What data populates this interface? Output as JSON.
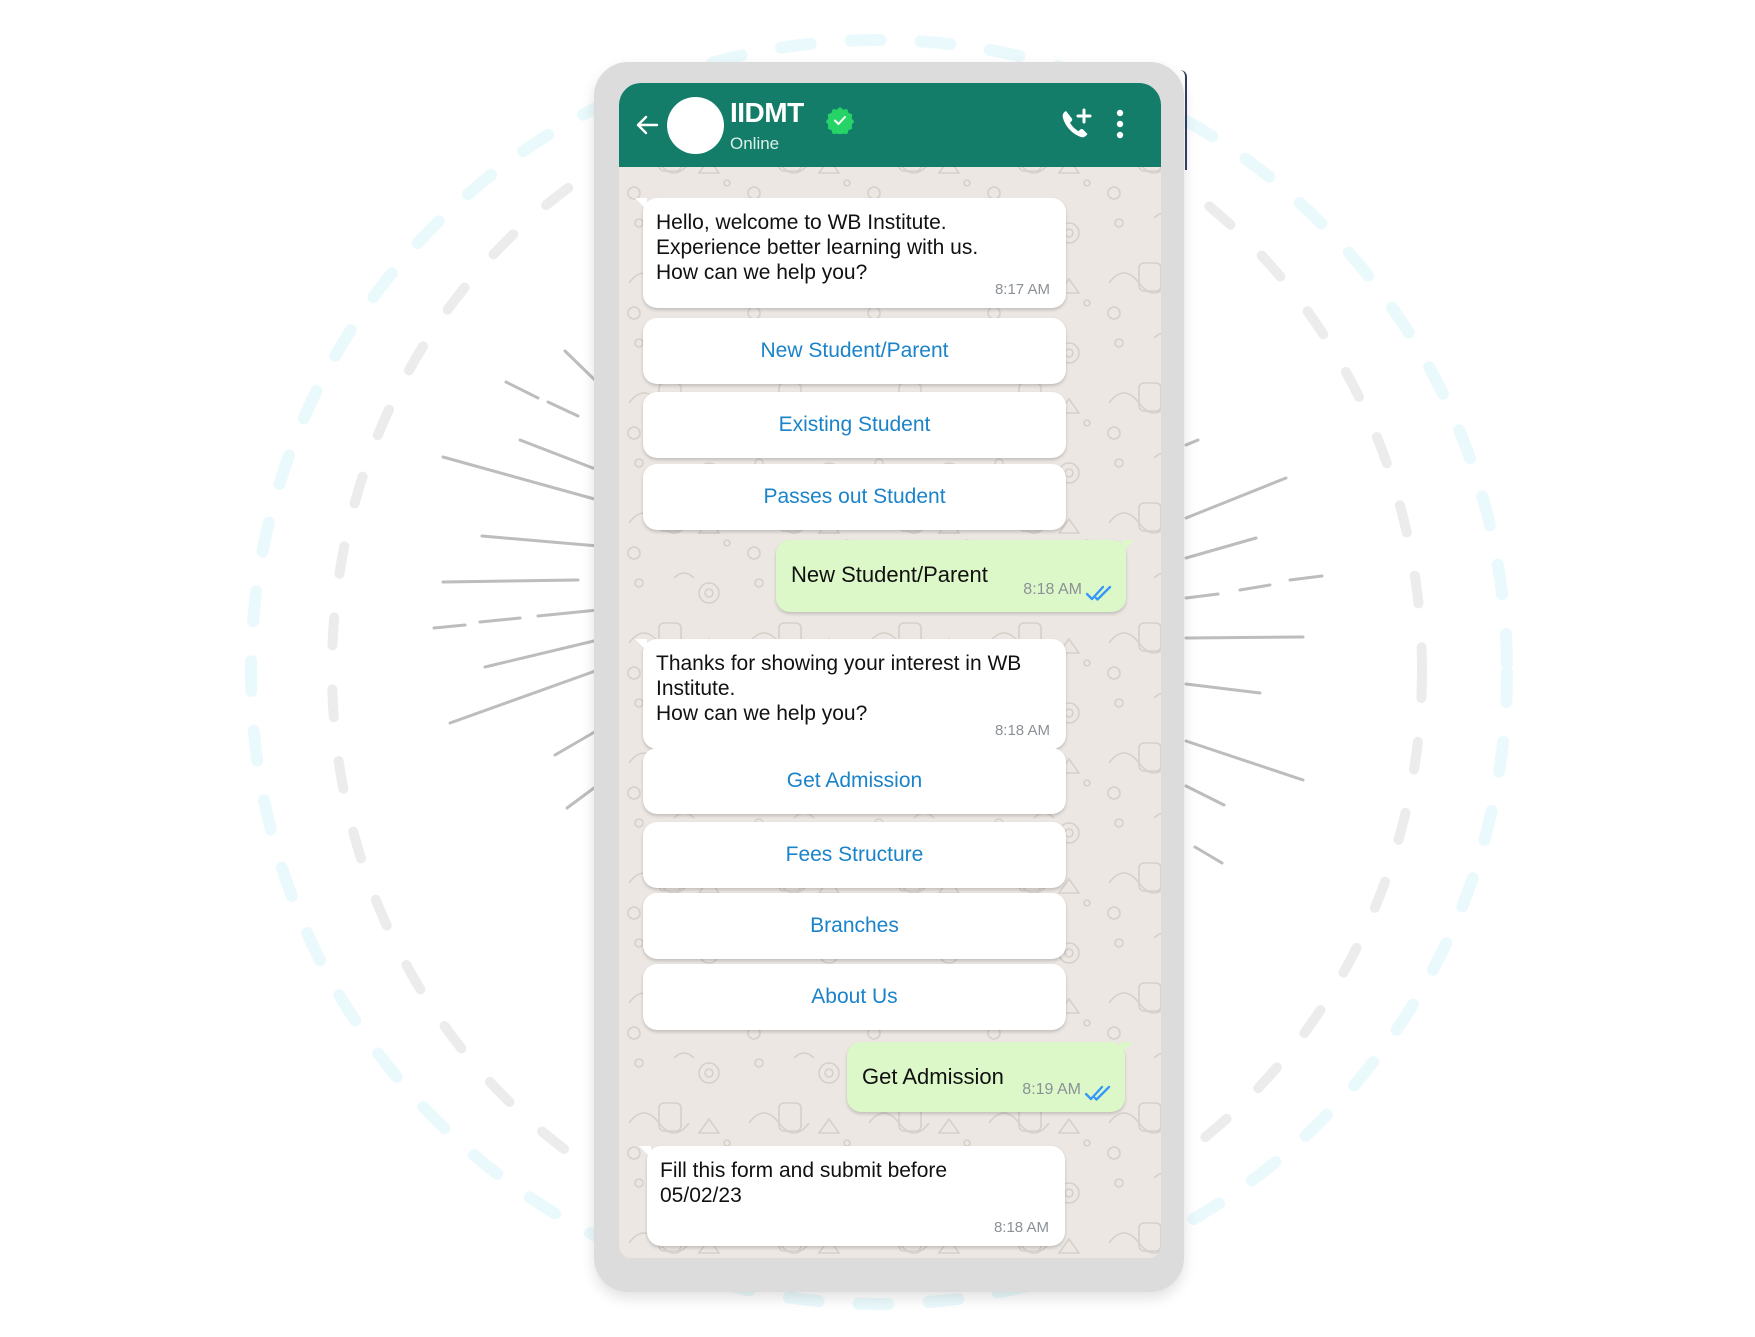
{
  "header": {
    "title": "IIDMT",
    "status": "Online",
    "verified": true,
    "icons": [
      "back-arrow-icon",
      "avatar",
      "verified-badge-icon",
      "add-call-icon",
      "more-vert-icon"
    ]
  },
  "colors": {
    "header_bg": "#137d69",
    "verified_badge": "#25d366",
    "incoming_bubble": "#ffffff",
    "outgoing_bubble": "#dcf8c8",
    "quick_reply_text": "#1b83c9",
    "read_ticks": "#3497f9",
    "chat_bg": "#ece7e3"
  },
  "messages": [
    {
      "direction": "incoming",
      "text": "Hello, welcome to WB Institute.\nExperience better learning with us.\nHow can we help you?",
      "time": "8:17 AM",
      "quick_replies": [
        "New Student/Parent",
        "Existing Student",
        "Passes out Student"
      ]
    },
    {
      "direction": "outgoing",
      "text": "New Student/Parent",
      "time": "8:18 AM",
      "status": "read"
    },
    {
      "direction": "incoming",
      "text": "Thanks for showing your interest in WB\nInstitute.\nHow can we help you?",
      "time": "8:18 AM",
      "quick_replies": [
        "Get Admission",
        "Fees Structure",
        "Branches",
        "About Us"
      ]
    },
    {
      "direction": "outgoing",
      "text": "Get Admission",
      "time": "8:19 AM",
      "status": "read"
    },
    {
      "direction": "incoming",
      "text": "Fill this form and submit before\n05/02/23",
      "time": "8:18 AM"
    }
  ]
}
